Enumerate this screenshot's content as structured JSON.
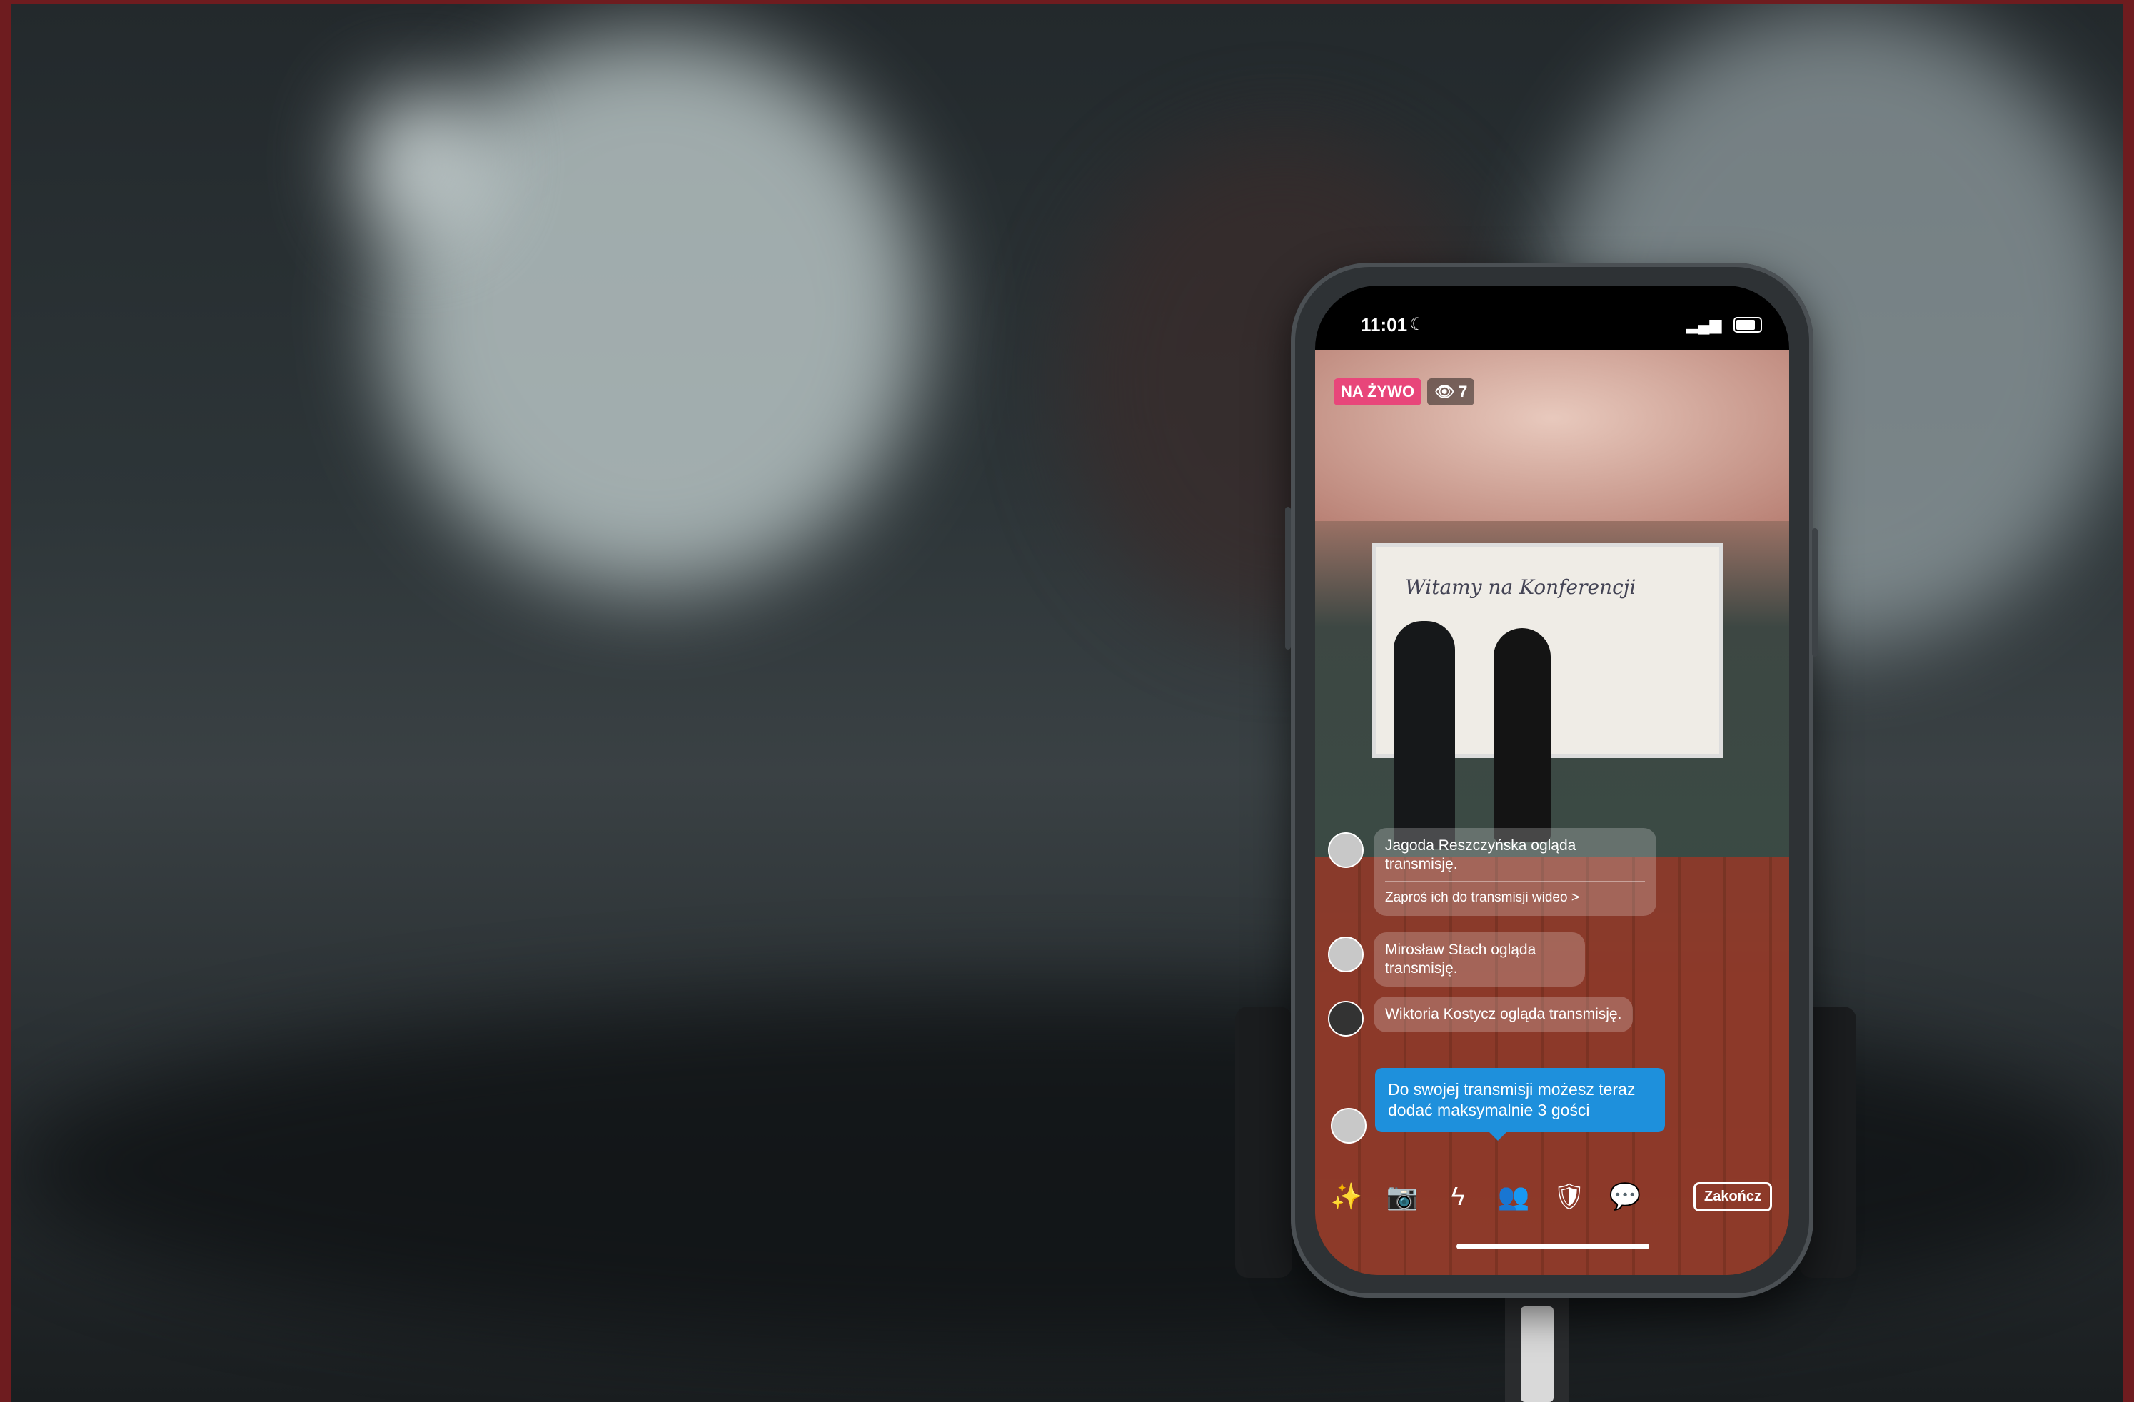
{
  "status_bar": {
    "time": "11:01",
    "moon_icon": "moon-icon"
  },
  "live": {
    "label": "NA ŻYWO",
    "viewers": "7"
  },
  "projector": {
    "title": "Witamy na Konferencji"
  },
  "comments": [
    {
      "name_text": "Jagoda Reszczyńska ogląda transmisję.",
      "invite": "Zaproś ich do transmisji wideo >"
    },
    {
      "name_text": "Mirosław Stach ogląda transmisję."
    },
    {
      "name_text": "Wiktoria Kostycz ogląda transmisję."
    }
  ],
  "notice": "Do swojej transmisji możesz teraz dodać maksymalnie 3 gości",
  "toolbar": {
    "icons": [
      "effects-icon",
      "camera-flip-icon",
      "flash-icon",
      "add-guest-icon",
      "shield-icon",
      "comment-icon"
    ],
    "end_label": "Zakończ"
  },
  "colors": {
    "live_badge": "#e8467a",
    "notice": "#1e90dc",
    "frame": "#6e1c1f"
  }
}
